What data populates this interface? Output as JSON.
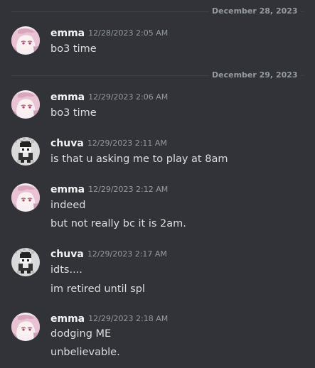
{
  "channel": {
    "dividers": [
      {
        "date": "December 28, 2023"
      },
      {
        "date": "December 29, 2023"
      }
    ],
    "messages": [
      {
        "username": "emma",
        "timestamp": "12/28/2023 2:05 AM",
        "avatar": "anime-girl-pink-hair",
        "lines": [
          "bo3 time"
        ]
      },
      {
        "username": "emma",
        "timestamp": "12/29/2023 2:06 AM",
        "avatar": "anime-girl-pink-hair",
        "lines": [
          "bo3 time"
        ]
      },
      {
        "username": "chuva",
        "timestamp": "12/29/2023 2:11 AM",
        "avatar": "pixel-trainer-sprite",
        "lines": [
          "is that u asking me to play at 8am"
        ]
      },
      {
        "username": "emma",
        "timestamp": "12/29/2023 2:12 AM",
        "avatar": "anime-girl-pink-hair",
        "lines": [
          "indeed",
          "but not really bc it is 2am."
        ]
      },
      {
        "username": "chuva",
        "timestamp": "12/29/2023 2:17 AM",
        "avatar": "pixel-trainer-sprite",
        "lines": [
          "idts....",
          "im retired until spl"
        ]
      },
      {
        "username": "emma",
        "timestamp": "12/29/2023 2:18 AM",
        "avatar": "anime-girl-pink-hair",
        "lines": [
          "dodging ME",
          "unbelievable."
        ]
      }
    ]
  },
  "colors": {
    "background": "#313338",
    "divider": "#3f4147",
    "username": "#f2f3f5",
    "timestamp": "#949ba4",
    "message_text": "#dbdee1"
  }
}
